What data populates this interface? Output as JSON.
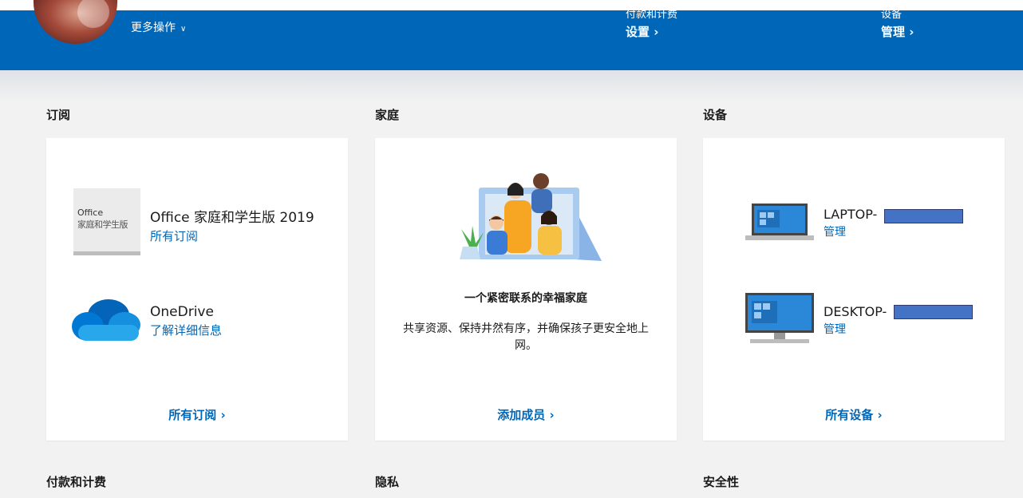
{
  "header": {
    "more_actions": "更多操作",
    "billing": {
      "title": "付款和计费",
      "link": "设置"
    },
    "devices": {
      "title": "设备",
      "link": "管理"
    }
  },
  "sections": {
    "subscriptions": {
      "title": "订阅",
      "products": [
        {
          "name": "Office 家庭和学生版 2019",
          "link": "所有订阅",
          "tile_line1": "Office",
          "tile_line2": "家庭和学生版"
        },
        {
          "name": "OneDrive",
          "link": "了解详细信息"
        }
      ],
      "footer_link": "所有订阅"
    },
    "family": {
      "title": "家庭",
      "heading": "一个紧密联系的幸福家庭",
      "description": "共享资源、保持井然有序，并确保孩子更安全地上网。",
      "footer_link": "添加成员"
    },
    "devices": {
      "title": "设备",
      "items": [
        {
          "name": "LAPTOP-",
          "link": "管理"
        },
        {
          "name": "DESKTOP-",
          "link": "管理"
        }
      ],
      "footer_link": "所有设备"
    }
  },
  "bottom_sections": [
    "付款和计费",
    "隐私",
    "安全性"
  ],
  "colors": {
    "brand": "#0067b8",
    "background": "#f2f2f2",
    "redaction": "#4472c4"
  }
}
